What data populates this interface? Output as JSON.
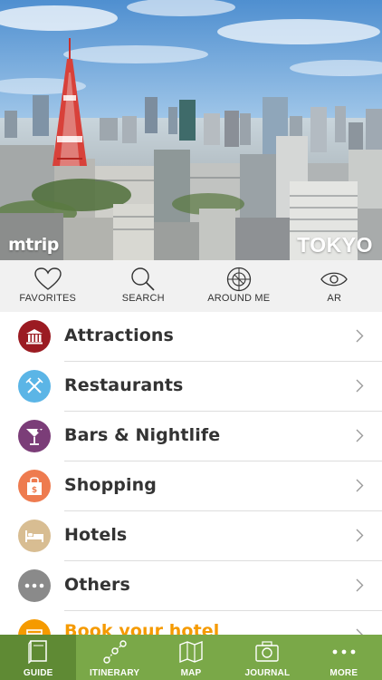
{
  "hero": {
    "brand": "mtrip",
    "city": "TOKYO"
  },
  "toolbar": {
    "items": [
      {
        "label": "FAVORITES",
        "icon": "heart-icon"
      },
      {
        "label": "SEARCH",
        "icon": "search-icon"
      },
      {
        "label": "AROUND ME",
        "icon": "crosshair-icon"
      },
      {
        "label": "AR",
        "icon": "eye-icon"
      }
    ]
  },
  "categories": [
    {
      "label": "Attractions",
      "icon": "museum-icon",
      "color": "#9b1b22"
    },
    {
      "label": "Restaurants",
      "icon": "fork-knife-icon",
      "color": "#5bb5e6"
    },
    {
      "label": "Bars & Nightlife",
      "icon": "cocktail-icon",
      "color": "#7b3d78"
    },
    {
      "label": "Shopping",
      "icon": "shopping-bag-icon",
      "color": "#ee7b4f"
    },
    {
      "label": "Hotels",
      "icon": "bed-icon",
      "color": "#d8bd92"
    },
    {
      "label": "Others",
      "icon": "more-icon",
      "color": "#8a8a8a"
    },
    {
      "label": "Book your hotel",
      "icon": "calendar-icon",
      "color": "#f59a00"
    }
  ],
  "tabbar": {
    "items": [
      {
        "label": "GUIDE",
        "icon": "book-icon",
        "active": true
      },
      {
        "label": "ITINERARY",
        "icon": "route-icon",
        "active": false
      },
      {
        "label": "MAP",
        "icon": "map-icon",
        "active": false
      },
      {
        "label": "JOURNAL",
        "icon": "camera-icon",
        "active": false
      },
      {
        "label": "MORE",
        "icon": "more-dots-icon",
        "active": false
      }
    ]
  },
  "colors": {
    "tabbar": "#7aa848",
    "tabbar_active": "#5f8a34",
    "toolbar": "#f1f1f1",
    "book_accent": "#f59a00"
  }
}
